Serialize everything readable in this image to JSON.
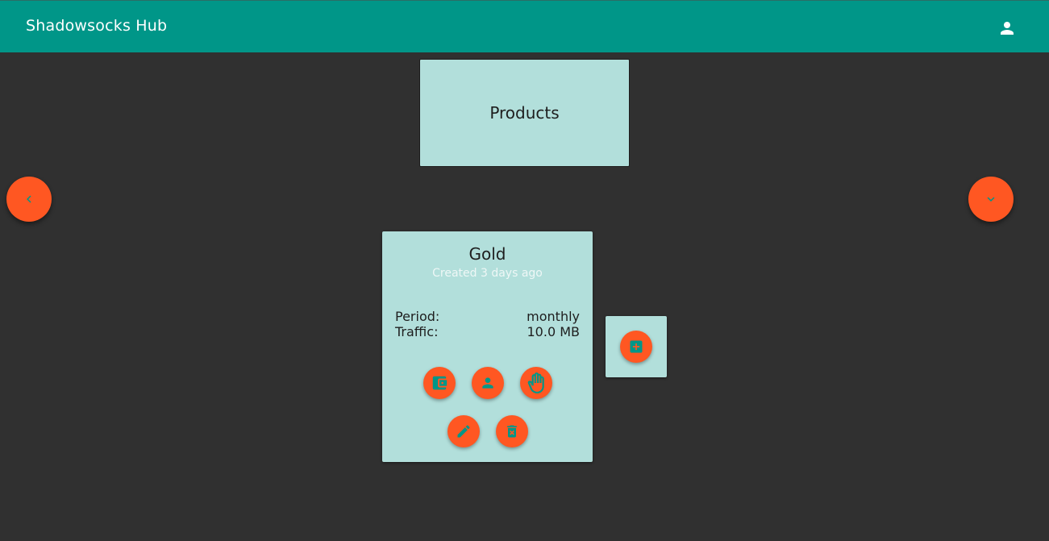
{
  "app": {
    "title": "Shadowsocks Hub",
    "account_icon": "account-icon"
  },
  "section": {
    "title": "Products"
  },
  "navigation": {
    "prev_icon": "chevron-left-icon",
    "next_icon": "chevron-down-icon"
  },
  "product": {
    "name": "Gold",
    "created": "Created 3 days ago",
    "fields": [
      {
        "label": "Period:",
        "value": "monthly"
      },
      {
        "label": "Traffic:",
        "value": "10.0 MB"
      }
    ],
    "actions": [
      {
        "icon": "wallet-icon"
      },
      {
        "icon": "person-icon"
      },
      {
        "icon": "hand-icon"
      },
      {
        "icon": "edit-icon"
      },
      {
        "icon": "delete-icon"
      }
    ]
  },
  "add_product": {
    "icon": "add-box-icon"
  },
  "colors": {
    "app_bar": "#009688",
    "background": "#303030",
    "card": "#b2dfdb",
    "accent": "#ff5722",
    "icon": "#009688"
  }
}
